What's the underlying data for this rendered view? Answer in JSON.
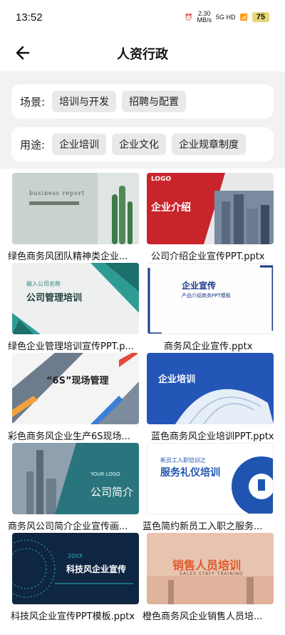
{
  "status": {
    "time": "13:52",
    "net_speed": "2.30",
    "net_unit": "MB/s",
    "signal": "5G HD",
    "battery": "75"
  },
  "header": {
    "title": "人资行政"
  },
  "filters": [
    {
      "label": "场景:",
      "chips": [
        "培训与开发",
        "招聘与配置"
      ]
    },
    {
      "label": "用途:",
      "chips": [
        "企业培训",
        "企业文化",
        "企业规章制度"
      ]
    }
  ],
  "items": [
    {
      "caption": "绿色商务风团队精神类企业...",
      "thumb": {
        "t1": "business report",
        "t2": ""
      }
    },
    {
      "caption": "公司介绍企业宣传PPT.pptx",
      "thumb": {
        "t1": "LOGO",
        "t2": "企业介绍"
      }
    },
    {
      "caption": "绿色企业管理培训宣传PPT.p...",
      "thumb": {
        "t1": "输入公司名称",
        "t2": "公司管理培训"
      }
    },
    {
      "caption": "商务风企业宣传.pptx",
      "thumb": {
        "t1": "企业宣传",
        "t2": "产品介绍商务PPT模板"
      }
    },
    {
      "caption": "彩色商务风企业生产6S现场...",
      "thumb": {
        "t1": "“6S”现场管理",
        "t2": ""
      }
    },
    {
      "caption": "蓝色商务风企业培训PPT.pptx",
      "thumb": {
        "t1": "企业培训",
        "t2": ""
      }
    },
    {
      "caption": "商务风公司简介企业宣传画...",
      "thumb": {
        "t1": "YOUR LOGO",
        "t2": "公司简介"
      }
    },
    {
      "caption": "蓝色简约新员工入职之服务...",
      "thumb": {
        "t1": "新员工入职培训之",
        "t2": "服务礼仪培训"
      }
    },
    {
      "caption": "科技风企业宣传PPT模板.pptx",
      "thumb": {
        "t1": "20XX",
        "t2": "科技风企业宣传"
      }
    },
    {
      "caption": "橙色商务风企业销售人员培...",
      "thumb": {
        "t1": "销售人员培训",
        "t2": "SALES STAFF TRAINING"
      }
    }
  ]
}
